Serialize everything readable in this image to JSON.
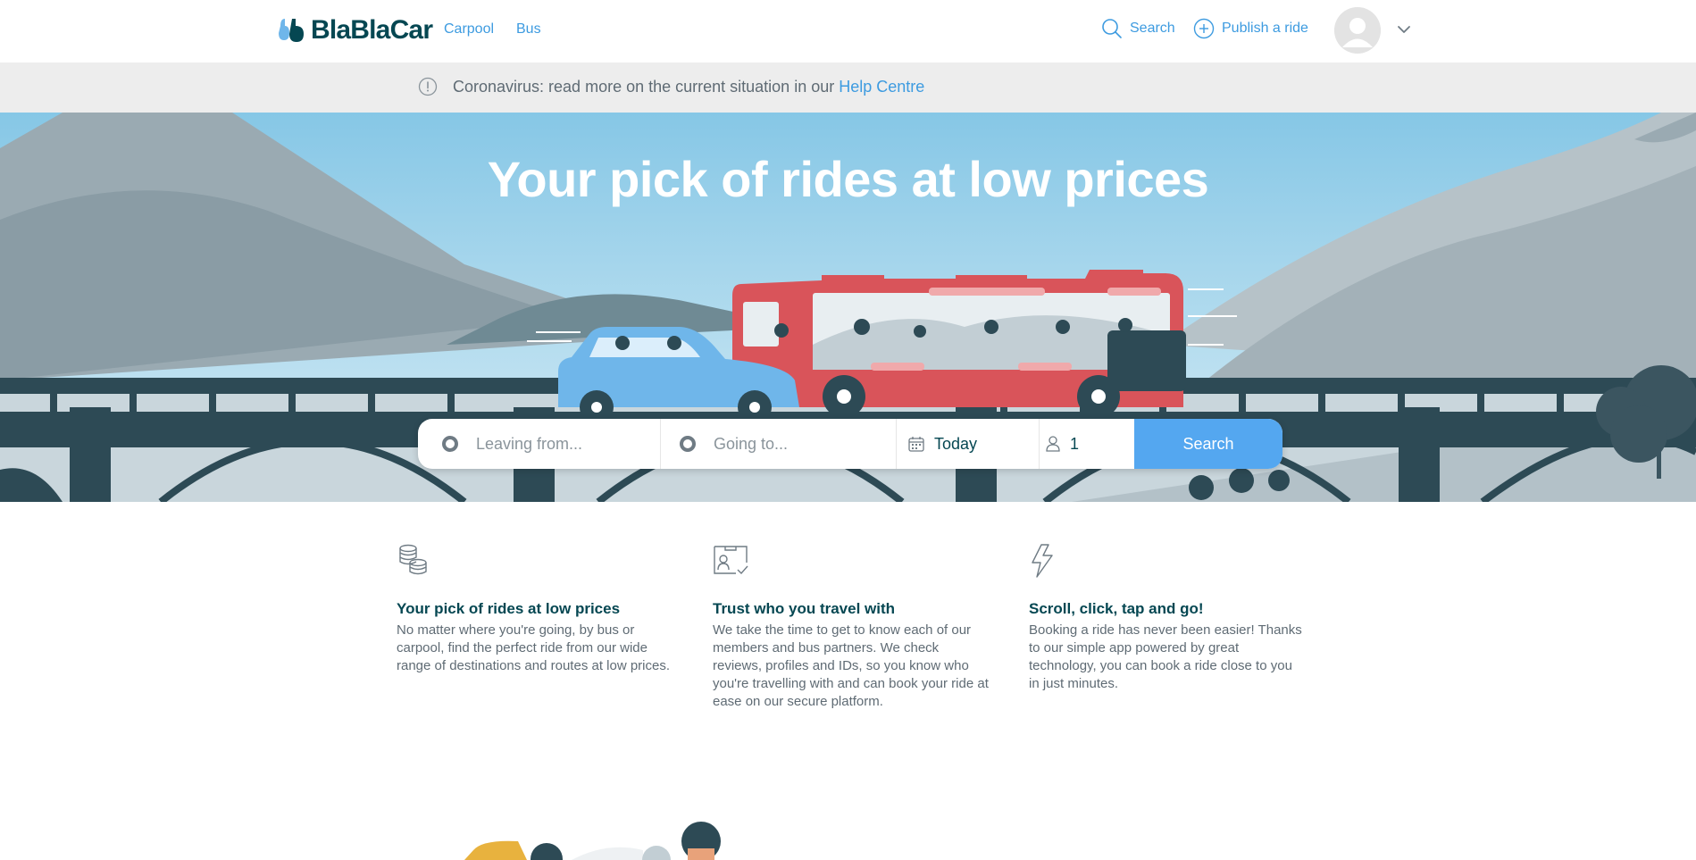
{
  "header": {
    "logo_text": "BlaBlaCar",
    "nav": [
      {
        "label": "Carpool"
      },
      {
        "label": "Bus"
      }
    ],
    "search_label": "Search",
    "publish_label": "Publish a ride"
  },
  "notice": {
    "text": "Coronavirus: read more on the current situation in our ",
    "link": "Help Centre"
  },
  "hero": {
    "title": "Your pick of rides at low prices"
  },
  "search_form": {
    "from_placeholder": "Leaving from...",
    "to_placeholder": "Going to...",
    "date_value": "Today",
    "passengers_value": "1",
    "button_label": "Search"
  },
  "features": [
    {
      "icon": "coins-icon",
      "title": "Your pick of rides at low prices",
      "text": "No matter where you're going, by bus or carpool, find the perfect ride from our wide range of destinations and routes at low prices."
    },
    {
      "icon": "verified-id-icon",
      "title": "Trust who you travel with",
      "text": "We take the time to get to know each of our members and bus partners. We check reviews, profiles and IDs, so you know who you're travelling with and can book your ride at ease on our secure platform."
    },
    {
      "icon": "lightning-icon",
      "title": "Scroll, click, tap and go!",
      "text": "Booking a ride has never been easier! Thanks to our simple app powered by great technology, you can book a ride close to you in just minutes."
    }
  ],
  "colors": {
    "brand_dark": "#054752",
    "link_blue": "#3d9be0",
    "search_button": "#54a7f0",
    "notice_bg": "#ededed",
    "sky": "#8ecde8",
    "bus_red": "#d9545a",
    "car_blue": "#6fb6ea",
    "bridge": "#2d4a55"
  }
}
